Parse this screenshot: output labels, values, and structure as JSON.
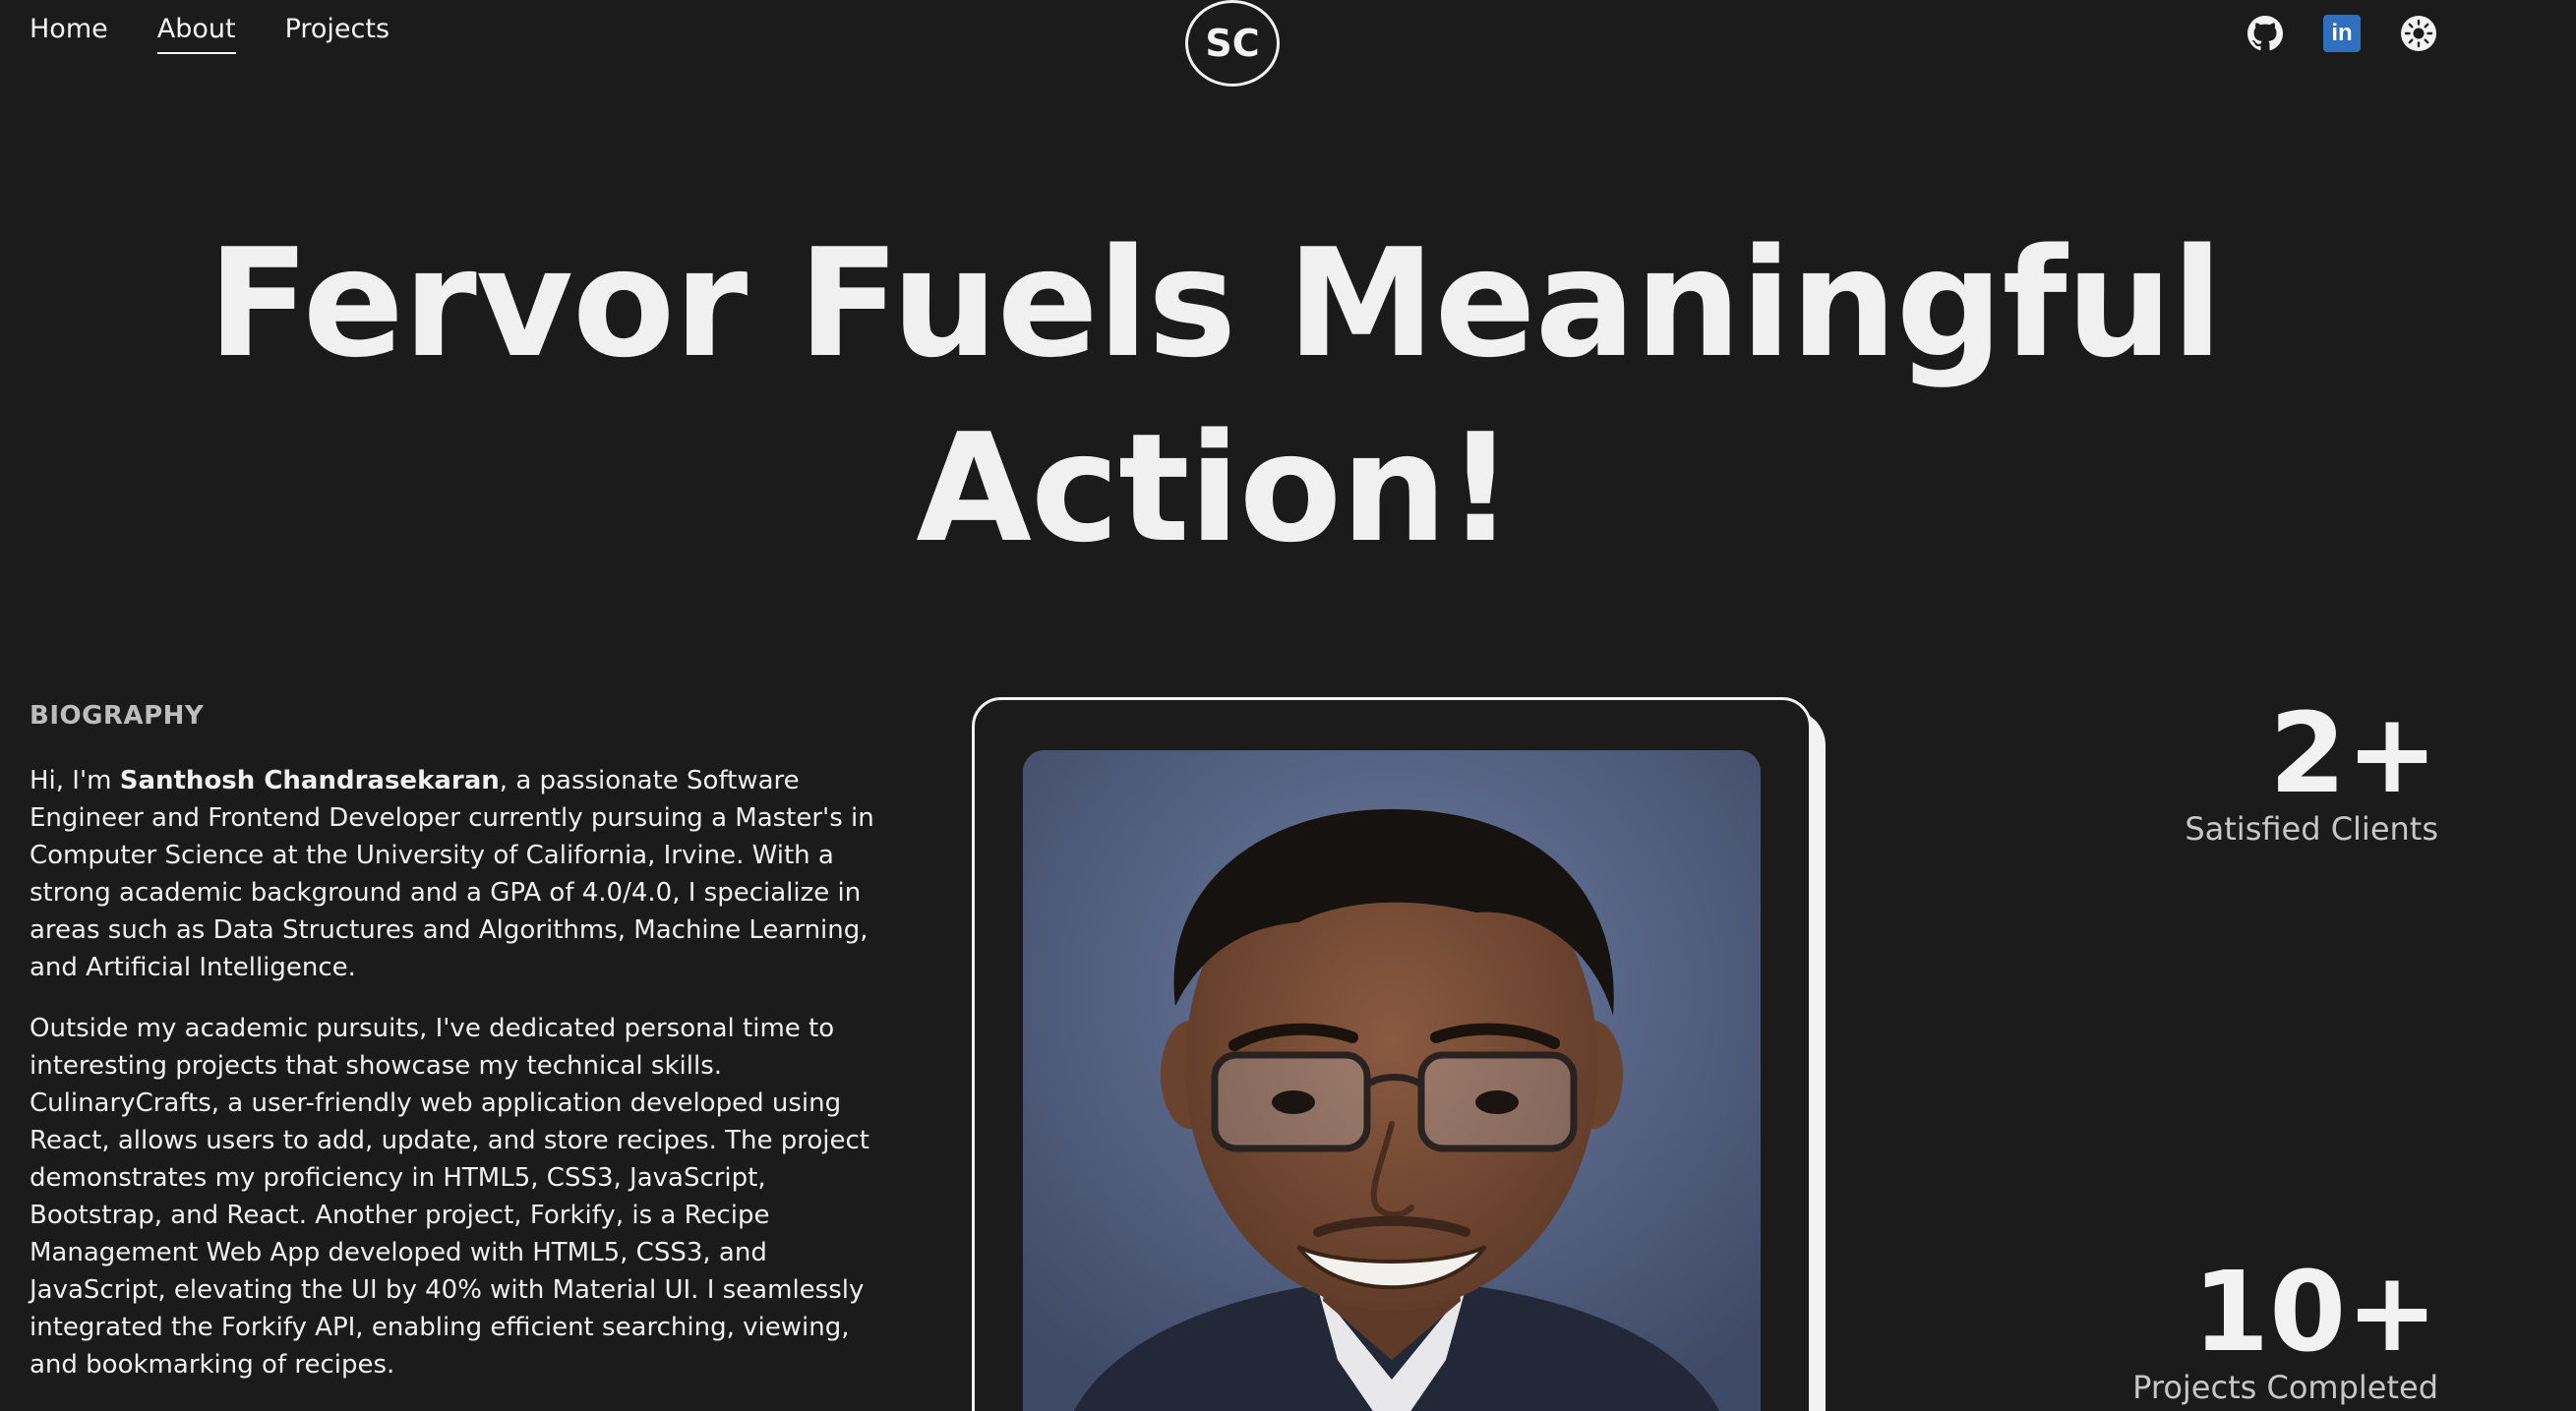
{
  "nav": {
    "links": [
      {
        "label": "Home",
        "active": false
      },
      {
        "label": "About",
        "active": true
      },
      {
        "label": "Projects",
        "active": false
      }
    ]
  },
  "logo": {
    "text": "SC"
  },
  "social": {
    "github_icon": "github-icon",
    "linkedin_text": "in",
    "theme_icon": "sun-icon"
  },
  "hero": {
    "line1": "Fervor Fuels Meaningful",
    "line2": "Action!"
  },
  "biography": {
    "heading": "BIOGRAPHY",
    "p1_intro": "Hi, I'm ",
    "p1_name": "Santhosh Chandrasekaran",
    "p1_rest": ", a passionate Software Engineer and Frontend Developer currently pursuing a Master's in Computer Science at the University of California, Irvine. With a strong academic background and a GPA of 4.0/4.0, I specialize in areas such as Data Structures and Algorithms, Machine Learning, and Artificial Intelligence.",
    "p2": "Outside my academic pursuits, I've dedicated personal time to interesting projects that showcase my technical skills. CulinaryCrafts, a user-friendly web application developed using React, allows users to add, update, and store recipes. The project demonstrates my proficiency in HTML5, CSS3, JavaScript, Bootstrap, and React. Another project, Forkify, is a Recipe Management Web App developed with HTML5, CSS3, and JavaScript, elevating the UI by 40% with Material UI. I seamlessly integrated the Forkify API, enabling efficient searching, viewing, and bookmarking of recipes."
  },
  "stats": [
    {
      "value": "2+",
      "label": "Satisfied Clients"
    },
    {
      "value": "10+",
      "label": "Projects Completed"
    }
  ],
  "colors": {
    "background": "#1b1b1b",
    "text": "#f2f2f2",
    "linkedin": "#2f6fbf"
  }
}
